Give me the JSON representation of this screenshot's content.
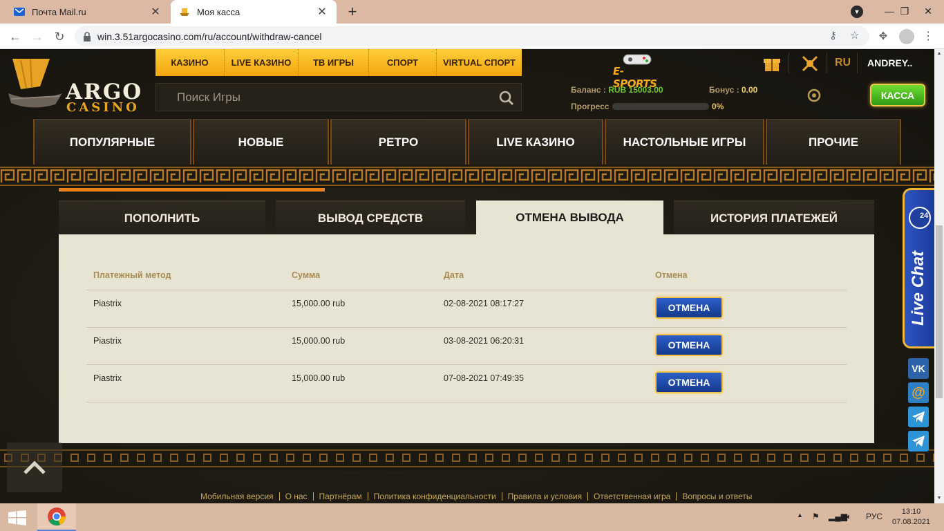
{
  "browser": {
    "tabs": [
      {
        "title": "Почта Mail.ru",
        "active": false
      },
      {
        "title": "Моя касса",
        "active": true
      }
    ],
    "url": "win.3.51argocasino.com/ru/account/withdraw-cancel"
  },
  "site": {
    "logo": {
      "argo": "ARGO",
      "casino": "CASINO"
    },
    "top_nav": [
      "КАЗИНО",
      "LIVE КАЗИНО",
      "ТВ ИГРЫ",
      "СПОРТ",
      "VIRTUAL СПОРТ"
    ],
    "search_placeholder": "Поиск Игры",
    "esports_label": "E-SPORTS",
    "language": "RU",
    "username": "ANDREY..",
    "balance": {
      "label": "Баланс :",
      "value": "RUB 15003.00"
    },
    "bonus": {
      "label": "Бонус :",
      "value": "0.00"
    },
    "progress": {
      "label": "Прогресс",
      "value": "0%",
      "fraction": 0
    },
    "kassa_button": "КАССА",
    "categories": [
      "ПОПУЛЯРНЫЕ",
      "НОВЫЕ",
      "РЕТРО",
      "LIVE КАЗИНО",
      "НАСТОЛЬНЫЕ ИГРЫ",
      "ПРОЧИЕ"
    ]
  },
  "cashier": {
    "tabs": [
      {
        "label": "ПОПОЛНИТЬ",
        "active": false
      },
      {
        "label": "ВЫВОД СРЕДСТВ",
        "active": false
      },
      {
        "label": "ОТМЕНА ВЫВОДА",
        "active": true
      },
      {
        "label": "ИСТОРИЯ ПЛАТЕЖЕЙ",
        "active": false
      }
    ],
    "columns": [
      "Платежный метод",
      "Сумма",
      "Дата",
      "Отмена"
    ],
    "rows": [
      {
        "method": "Piastrix",
        "amount": "15,000.00 rub",
        "date": "02-08-2021 08:17:27",
        "action": "ОТМЕНА"
      },
      {
        "method": "Piastrix",
        "amount": "15,000.00 rub",
        "date": "03-08-2021 06:20:31",
        "action": "ОТМЕНА"
      },
      {
        "method": "Piastrix",
        "amount": "15,000.00 rub",
        "date": "07-08-2021 07:49:35",
        "action": "ОТМЕНА"
      }
    ]
  },
  "footer_links": [
    "Мобильная версия",
    "О нас",
    "Партнёрам",
    "Политика конфиденциальности",
    "Правила и условия",
    "Ответственная игра",
    "Вопросы и ответы"
  ],
  "live_chat": {
    "label": "Live Chat",
    "badge": "24"
  },
  "social_icons": [
    "vk-icon",
    "mail-at-icon",
    "telegram-icon",
    "telegram-icon"
  ],
  "taskbar": {
    "language": "РУС",
    "time": "13:10",
    "date": "07.08.2021"
  },
  "colors": {
    "gold": "#f2a50d",
    "panel": "#e8e4d3",
    "kassa_green": "#3aa81a",
    "cancel_blue": "#1f4aa8",
    "orange_line": "#e8821c"
  }
}
